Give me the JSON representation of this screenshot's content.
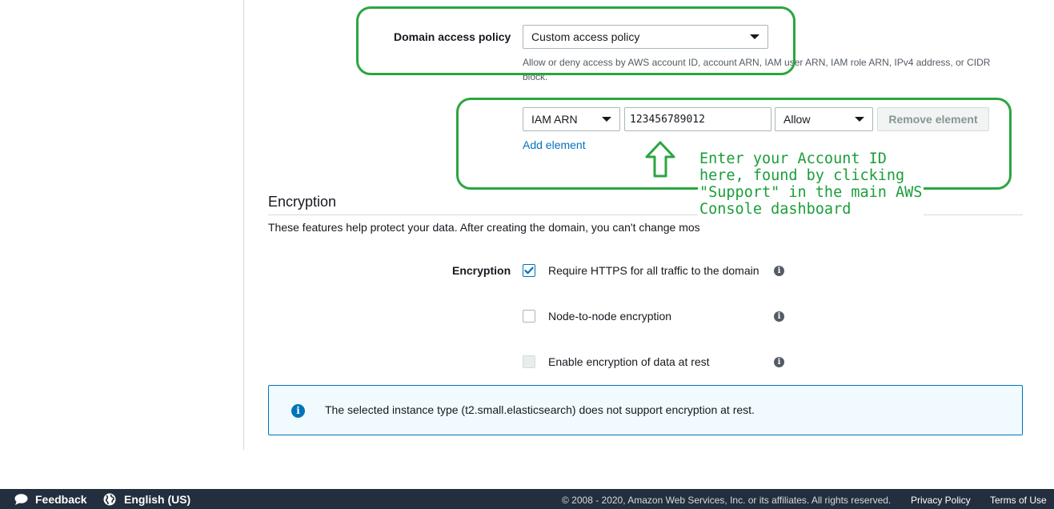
{
  "access_policy": {
    "label": "Domain access policy",
    "selected": "Custom access policy",
    "hint": "Allow or deny access by AWS account ID, account ARN, IAM user ARN, IAM role ARN, IPv4 address, or CIDR block."
  },
  "policy_element": {
    "type_selected": "IAM ARN",
    "value": "123456789012",
    "effect_selected": "Allow",
    "remove_label": "Remove element",
    "add_label": "Add element"
  },
  "annotation": {
    "text": "Enter your Account ID\nhere, found by clicking\n\"Support\" in the main AWS\nConsole dashboard",
    "color": "#2aa640"
  },
  "encryption": {
    "title": "Encryption",
    "description": "These features help protect your data. After creating the domain, you can't change mos",
    "label": "Encryption",
    "options": [
      {
        "label": "Require HTTPS for all traffic to the domain",
        "checked": true
      },
      {
        "label": "Node-to-node encryption",
        "checked": false
      },
      {
        "label": "Enable encryption of data at rest",
        "checked": false,
        "disabled": true
      }
    ],
    "alert": "The selected instance type (t2.small.elasticsearch) does not support encryption at rest."
  },
  "footer": {
    "feedback": "Feedback",
    "language": "English (US)",
    "copyright": "© 2008 - 2020, Amazon Web Services, Inc. or its affiliates. All rights reserved.",
    "privacy": "Privacy Policy",
    "terms": "Terms of Use"
  },
  "colors": {
    "link": "#0073bb",
    "footer_bg": "#232f3e",
    "annotation_green": "#2aa640"
  }
}
